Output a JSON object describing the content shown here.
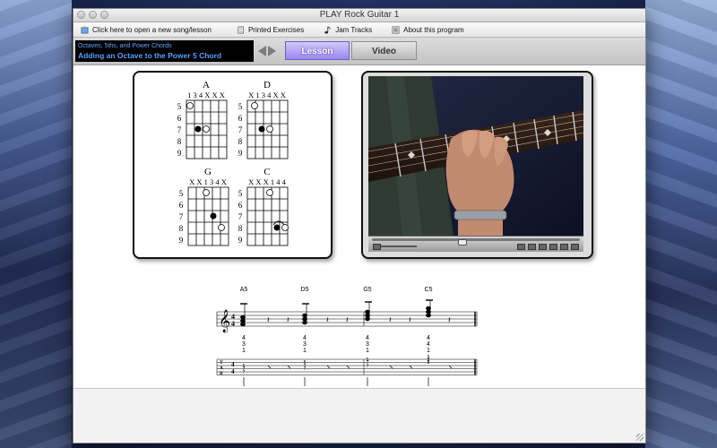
{
  "window": {
    "title": "PLAY Rock Guitar 1"
  },
  "menu": {
    "items": [
      {
        "label": "Click here to open a new song/lesson",
        "icon": "open-song-icon"
      },
      {
        "label": "Printed Exercises",
        "icon": "document-icon"
      },
      {
        "label": "Jam Tracks",
        "icon": "music-note-icon"
      },
      {
        "label": "About this program",
        "icon": "info-icon"
      }
    ]
  },
  "lesson": {
    "chapter": "Octaves, 5ths, and Power Chords",
    "title": "Adding an Octave to the Power 5 Chord"
  },
  "tabs": {
    "lesson": "Lesson",
    "video": "Video",
    "active": "lesson"
  },
  "chords": [
    {
      "name": "A",
      "fingering": "1 3 4 X X X",
      "frets": [
        "5",
        "6",
        "7",
        "8",
        "9"
      ]
    },
    {
      "name": "D",
      "fingering": "X 1 3 4 X X",
      "frets": [
        "5",
        "6",
        "7",
        "8",
        "9"
      ]
    },
    {
      "name": "G",
      "fingering": "X X 1 3 4 X",
      "frets": [
        "5",
        "6",
        "7",
        "8",
        "9"
      ]
    },
    {
      "name": "C",
      "fingering": "X X X 1 4 4",
      "frets": [
        "5",
        "6",
        "7",
        "8",
        "9"
      ]
    }
  ],
  "notation": {
    "chord_labels": [
      "A5",
      "D5",
      "G5",
      "C5"
    ],
    "time_signature": "4/4",
    "tab_fingers": [
      [
        "4",
        "3",
        "1"
      ],
      [
        "4",
        "3",
        "1"
      ],
      [
        "4",
        "3",
        "1"
      ],
      [
        "4",
        "4",
        "1"
      ]
    ],
    "tab_label": "TAB"
  },
  "video": {
    "playing": false
  }
}
